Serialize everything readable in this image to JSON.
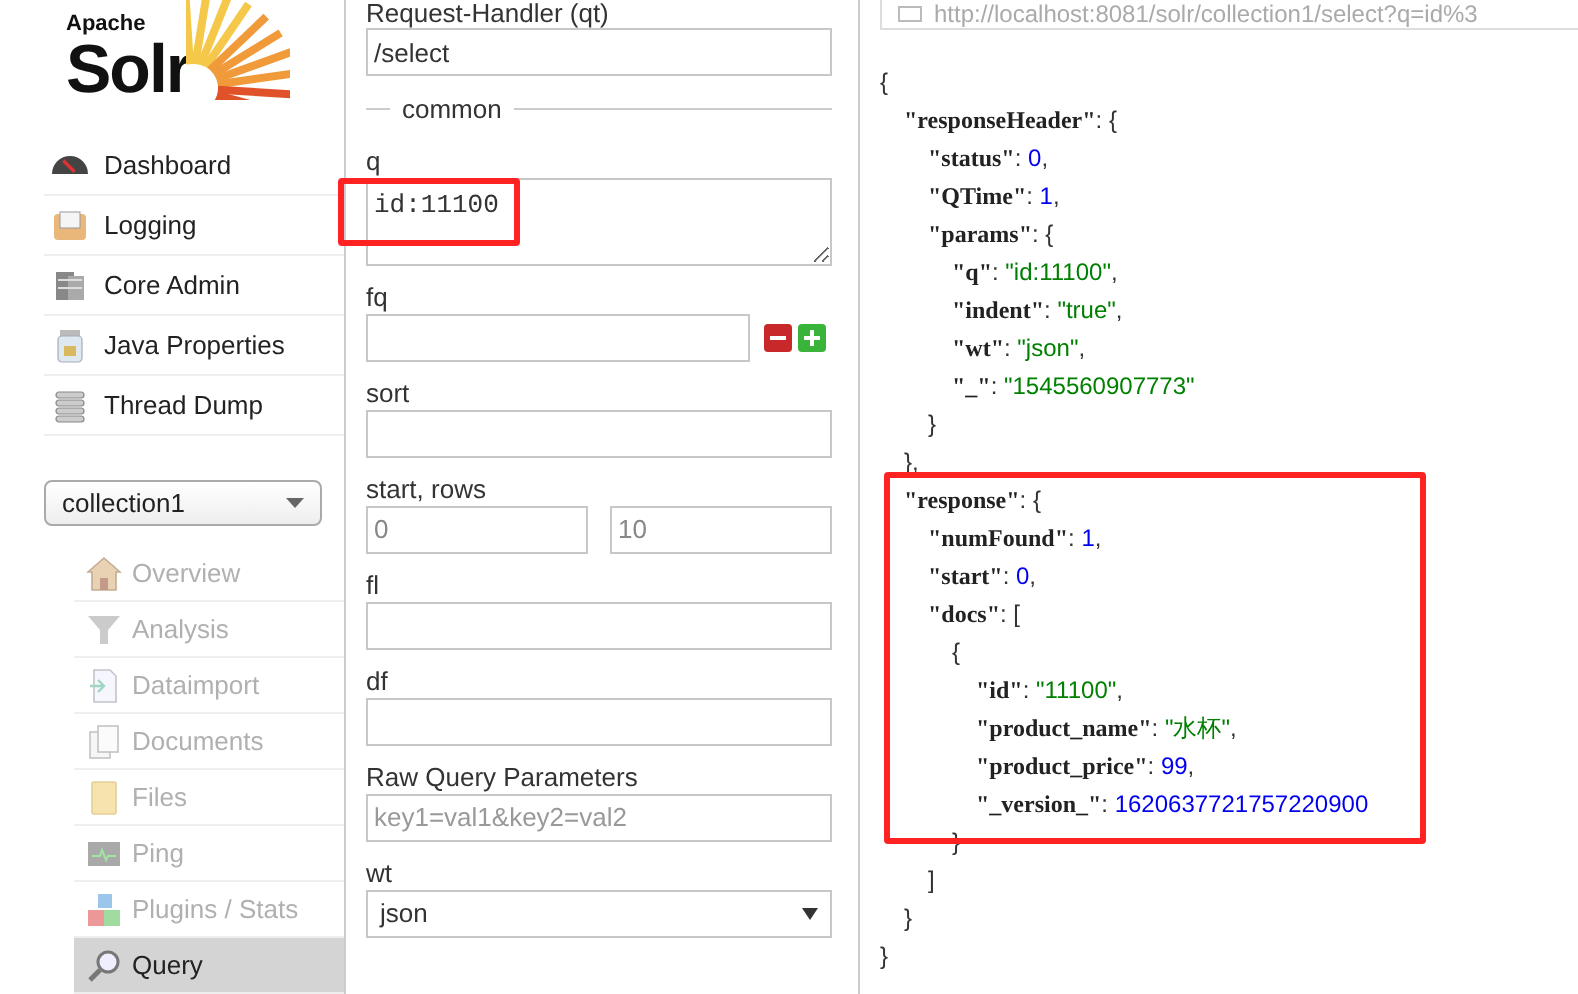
{
  "logo": {
    "small": "Apache",
    "large": "Solr"
  },
  "nav": [
    {
      "label": "Dashboard"
    },
    {
      "label": "Logging"
    },
    {
      "label": "Core Admin"
    },
    {
      "label": "Java Properties"
    },
    {
      "label": "Thread Dump"
    }
  ],
  "core_selector": {
    "value": "collection1"
  },
  "core_menu": [
    {
      "label": "Overview",
      "disabled": true,
      "selected": false
    },
    {
      "label": "Analysis",
      "disabled": true,
      "selected": false
    },
    {
      "label": "Dataimport",
      "disabled": true,
      "selected": false
    },
    {
      "label": "Documents",
      "disabled": true,
      "selected": false
    },
    {
      "label": "Files",
      "disabled": true,
      "selected": false
    },
    {
      "label": "Ping",
      "disabled": true,
      "selected": false
    },
    {
      "label": "Plugins / Stats",
      "disabled": true,
      "selected": false
    },
    {
      "label": "Query",
      "disabled": false,
      "selected": true
    }
  ],
  "form": {
    "handler": {
      "label": "Request-Handler (qt)",
      "value": "/select"
    },
    "section": "common",
    "fields": [
      {
        "kind": "textarea",
        "label": "q",
        "value": "id:11100",
        "highlighted": true
      },
      {
        "kind": "filter",
        "label": "fq"
      },
      {
        "kind": "text",
        "label": "sort"
      },
      {
        "kind": "pair",
        "label": "start, rows",
        "values": [
          "0",
          "10"
        ]
      },
      {
        "kind": "text",
        "label": "fl"
      },
      {
        "kind": "text",
        "label": "df"
      },
      {
        "kind": "text",
        "label": "Raw Query Parameters",
        "placeholder": "key1=val1&key2=val2"
      },
      {
        "kind": "select",
        "label": "wt",
        "value": "json"
      }
    ]
  },
  "result": {
    "url": "http://localhost:8081/solr/collection1/select?q=id%3",
    "json": {
      "open": "{",
      "close": "}",
      "children": [
        {
          "key": "\"responseHeader\"",
          "sep": ": ",
          "open": "{",
          "close": "},",
          "children": [
            {
              "key": "\"status\"",
              "sep": ": ",
              "value": "0",
              "kind": "number",
              "end": ","
            },
            {
              "key": "\"QTime\"",
              "sep": ": ",
              "value": "1",
              "kind": "number",
              "end": ","
            },
            {
              "key": "\"params\"",
              "sep": ": ",
              "open": "{",
              "close": "}",
              "children": [
                {
                  "key": "\"q\"",
                  "sep": ": ",
                  "value": "\"id:11100\"",
                  "kind": "string",
                  "end": ","
                },
                {
                  "key": "\"indent\"",
                  "sep": ": ",
                  "value": "\"true\"",
                  "kind": "string",
                  "end": ","
                },
                {
                  "key": "\"wt\"",
                  "sep": ": ",
                  "value": "\"json\"",
                  "kind": "string",
                  "end": ","
                },
                {
                  "key": "\"_\"",
                  "sep": ": ",
                  "value": "\"1545560907773\"",
                  "kind": "string"
                }
              ]
            }
          ]
        },
        {
          "key": "\"response\"",
          "sep": ": ",
          "open": "{",
          "close": "}",
          "highlighted": true,
          "children": [
            {
              "key": "\"numFound\"",
              "sep": ": ",
              "value": "1",
              "kind": "number",
              "end": ","
            },
            {
              "key": "\"start\"",
              "sep": ": ",
              "value": "0",
              "kind": "number",
              "end": ","
            },
            {
              "key": "\"docs\"",
              "sep": ": ",
              "open": "[",
              "close": "]",
              "children": [
                {
                  "open": "{",
                  "close": "}",
                  "children": [
                    {
                      "key": "\"id\"",
                      "sep": ": ",
                      "value": "\"11100\"",
                      "kind": "string",
                      "end": ","
                    },
                    {
                      "key": "\"product_name\"",
                      "sep": ": ",
                      "value": "\"水杯\"",
                      "kind": "string",
                      "end": ","
                    },
                    {
                      "key": "\"product_price\"",
                      "sep": ": ",
                      "value": "99",
                      "kind": "number",
                      "end": ","
                    },
                    {
                      "key": "\"_version_\"",
                      "sep": ": ",
                      "value": "1620637721757220900",
                      "kind": "number"
                    }
                  ]
                }
              ]
            }
          ]
        }
      ]
    }
  }
}
